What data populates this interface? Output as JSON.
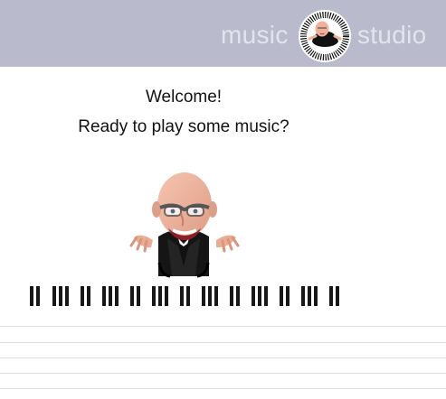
{
  "header": {
    "brand_left": "music",
    "brand_right": "studio",
    "logo_icon": "piano-keyboard-logo-icon",
    "background_color": "#b9bbcc"
  },
  "content": {
    "welcome": "Welcome!",
    "subtitle": "Ready to play some music?"
  },
  "illustrations": {
    "mascot": "bald-pianist-mascot-icon",
    "keyboard": "piano-black-keys-icon"
  }
}
